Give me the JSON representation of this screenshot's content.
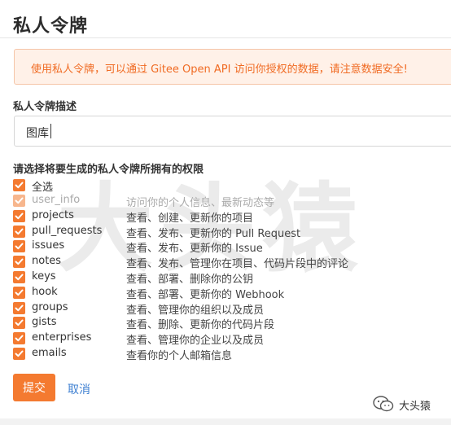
{
  "page": {
    "title": "私人令牌"
  },
  "alert": {
    "text": "使用私人令牌，可以通过 Gitee Open API 访问你授权的数据，请注意数据安全!"
  },
  "token_description": {
    "label": "私人令牌描述",
    "value": "图库"
  },
  "permissions": {
    "label": "请选择将要生成的私人令牌所拥有的权限",
    "select_all": {
      "name": "全选",
      "checked": true
    },
    "items": [
      {
        "name": "user_info",
        "desc": "访问你的个人信息、最新动态等",
        "checked": true,
        "disabled": true
      },
      {
        "name": "projects",
        "desc": "查看、创建、更新你的项目",
        "checked": true,
        "disabled": false
      },
      {
        "name": "pull_requests",
        "desc": "查看、发布、更新你的 Pull Request",
        "checked": true,
        "disabled": false
      },
      {
        "name": "issues",
        "desc": "查看、发布、更新你的 Issue",
        "checked": true,
        "disabled": false
      },
      {
        "name": "notes",
        "desc": "查看、发布、管理你在项目、代码片段中的评论",
        "checked": true,
        "disabled": false
      },
      {
        "name": "keys",
        "desc": "查看、部署、删除你的公钥",
        "checked": true,
        "disabled": false
      },
      {
        "name": "hook",
        "desc": "查看、部署、更新你的 Webhook",
        "checked": true,
        "disabled": false
      },
      {
        "name": "groups",
        "desc": "查看、管理你的组织以及成员",
        "checked": true,
        "disabled": false
      },
      {
        "name": "gists",
        "desc": "查看、删除、更新你的代码片段",
        "checked": true,
        "disabled": false
      },
      {
        "name": "enterprises",
        "desc": "查看、管理你的企业以及成员",
        "checked": true,
        "disabled": false
      },
      {
        "name": "emails",
        "desc": "查看你的个人邮箱信息",
        "checked": true,
        "disabled": false
      }
    ]
  },
  "actions": {
    "submit_label": "提交",
    "cancel_label": "取消"
  },
  "watermark": {
    "text": "大头猿",
    "wechat_account": "大头猿"
  },
  "colors": {
    "accent": "#f47a30",
    "alert_bg": "#fff1e8",
    "alert_border": "#f5c5a8",
    "alert_text": "#f06b23",
    "link": "#3d7fd1"
  },
  "icons": {
    "checkbox": "check-icon",
    "wechat": "wechat-icon"
  }
}
